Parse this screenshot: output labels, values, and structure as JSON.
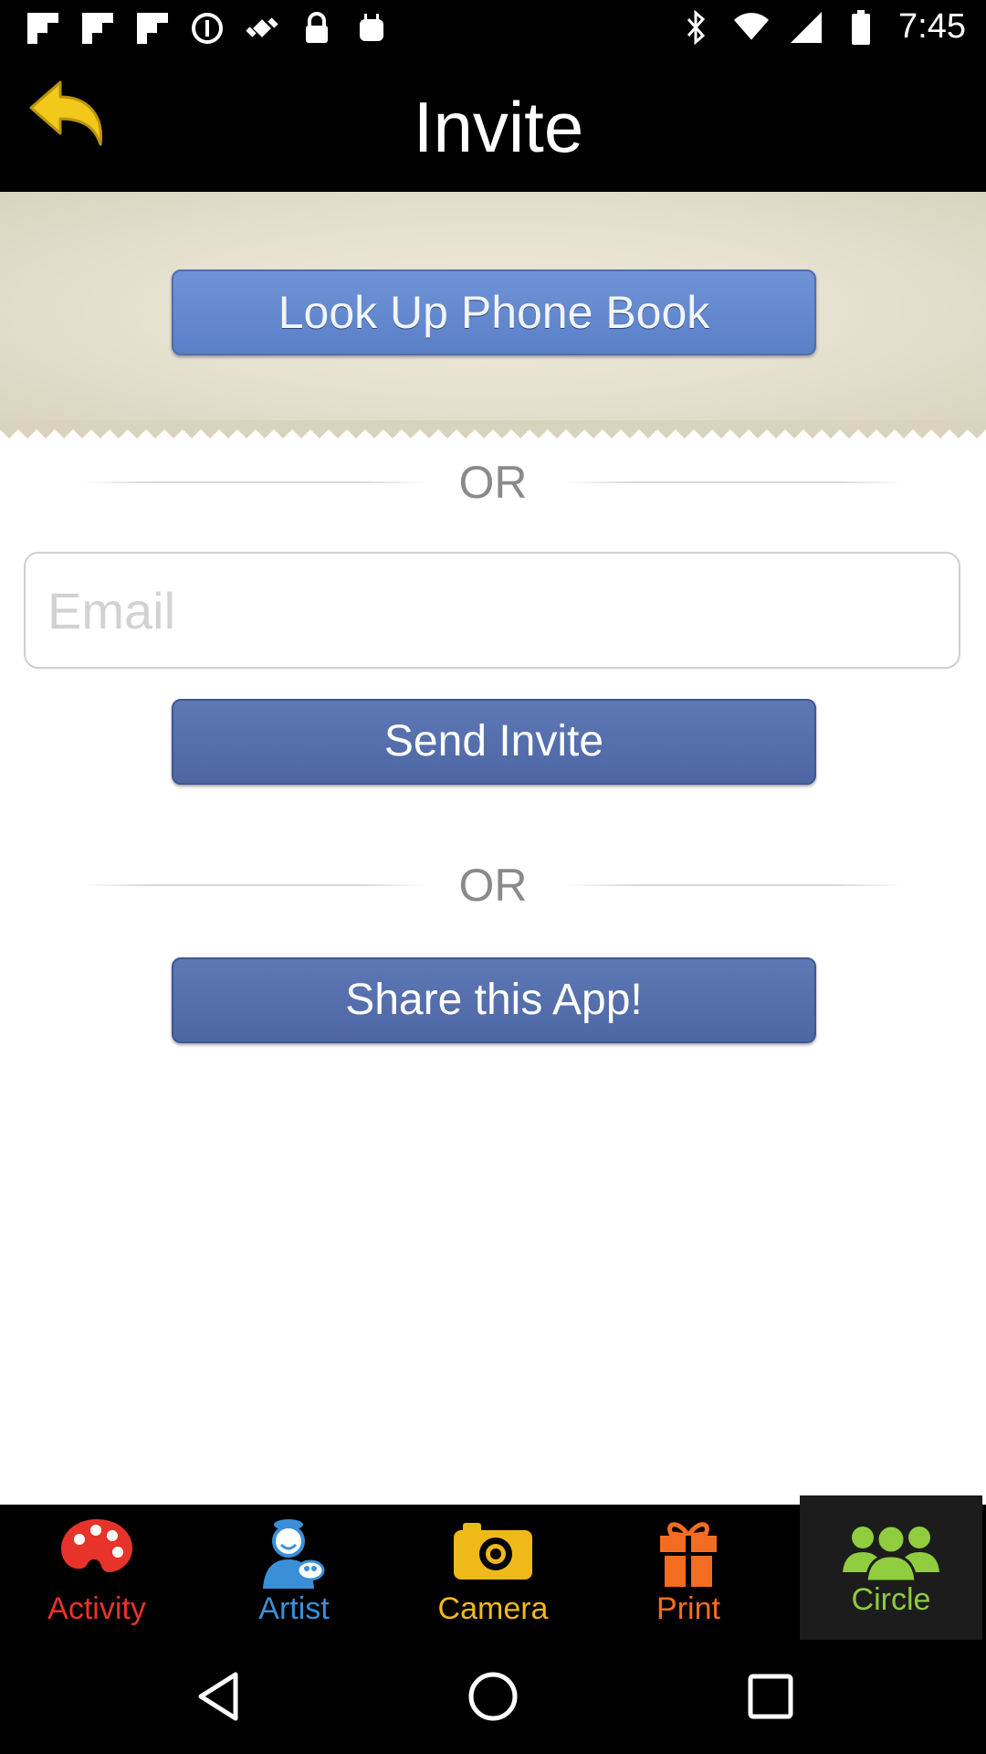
{
  "status_bar": {
    "time": "7:45",
    "icons": [
      "flipboard-icon",
      "flipboard-icon",
      "flipboard-icon",
      "data-saver-icon",
      "fake-gps-icon",
      "lock-icon",
      "android-icon",
      "bluetooth-icon",
      "wifi-icon",
      "signal-icon",
      "battery-icon"
    ]
  },
  "header": {
    "title": "Invite",
    "back_icon": "reply-arrow-icon",
    "back_color": "#f2c81a"
  },
  "main": {
    "lookup_button": "Look Up Phone Book",
    "or_1": "OR",
    "email_placeholder": "Email",
    "send_button": "Send Invite",
    "or_2": "OR",
    "share_button": "Share this App!"
  },
  "tabs": [
    {
      "label": "Activity",
      "icon": "palette-icon",
      "color": "#e8332a"
    },
    {
      "label": "Artist",
      "icon": "artist-icon",
      "color": "#3a8fd8"
    },
    {
      "label": "Camera",
      "icon": "camera-icon",
      "color": "#f0b91a"
    },
    {
      "label": "Print",
      "icon": "gift-icon",
      "color": "#f26d21"
    },
    {
      "label": "Circle",
      "icon": "people-icon",
      "color": "#8fcd3e",
      "selected": true
    }
  ],
  "nav": [
    "back-triangle-icon",
    "home-circle-icon",
    "recents-square-icon"
  ]
}
